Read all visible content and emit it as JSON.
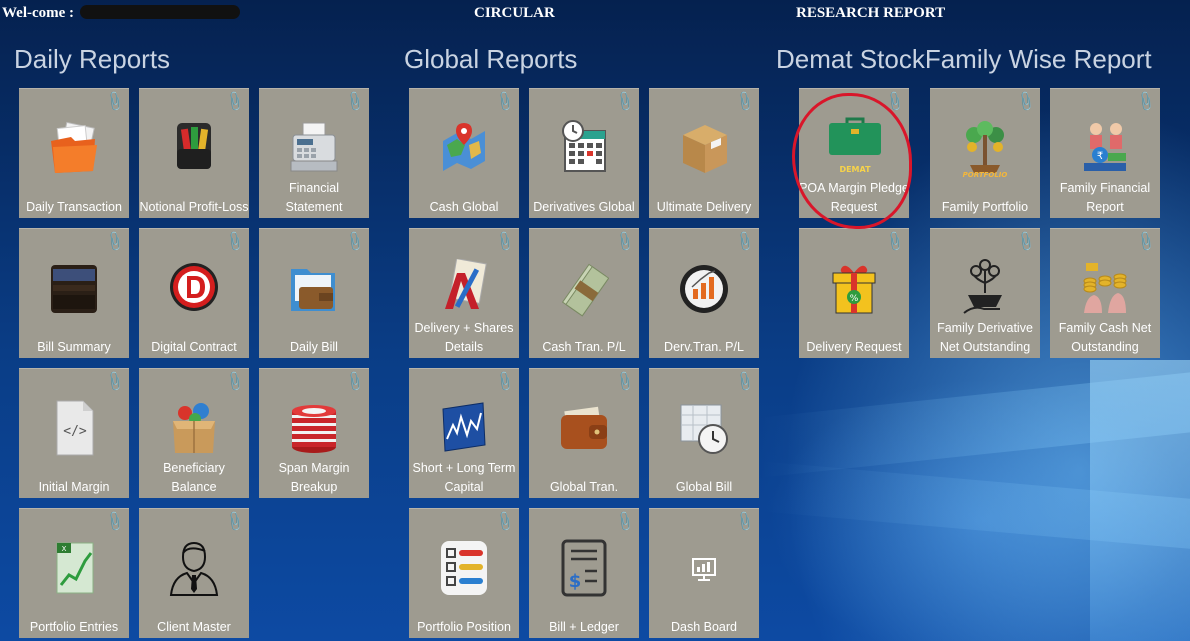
{
  "topbar": {
    "welcome": "Wel-come :",
    "circular": "CIRCULAR",
    "research": "RESEARCH REPORT"
  },
  "sections": {
    "daily": "Daily Reports",
    "global": "Global Reports",
    "demat": "Demat StockFamily Wise Report"
  },
  "tiles": {
    "daily_transaction": "Daily Transaction",
    "notional": "Notional Profit-Loss",
    "financial_statement": "Financial Statement",
    "bill_summary": "Bill Summary",
    "digital_contract": "Digital Contract",
    "daily_bill": "Daily Bill",
    "initial_margin": "Initial Margin",
    "beneficiary_balance": "Beneficiary Balance",
    "span_margin": "Span Margin Breakup",
    "portfolio_entries": "Portfolio Entries",
    "client_master": "Client Master",
    "cash_global": "Cash Global",
    "derivatives_global": "Derivatives Global",
    "ultimate_delivery": "Ultimate Delivery",
    "delivery_shares": "Delivery + Shares Details",
    "cash_tran": "Cash Tran. P/L",
    "derv_tran": "Derv.Tran. P/L",
    "short_long": "Short + Long Term Capital",
    "global_tran": "Global Tran.",
    "global_bill": "Global Bill",
    "portfolio_position": "Portfolio Position",
    "bill_ledger": "Bill + Ledger",
    "dash_board": "Dash Board",
    "poa_margin": "POA Margin Pledge Request",
    "family_portfolio": "Family Portfolio",
    "family_financial": "Family Financial Report",
    "delivery_request": "Delivery Request",
    "family_derivative": "Family Derivative Net Outstanding",
    "family_cash": "Family Cash Net Outstanding"
  },
  "icon_text": {
    "demat": "DEMAT",
    "portfolio": "PORTFOLIO"
  }
}
